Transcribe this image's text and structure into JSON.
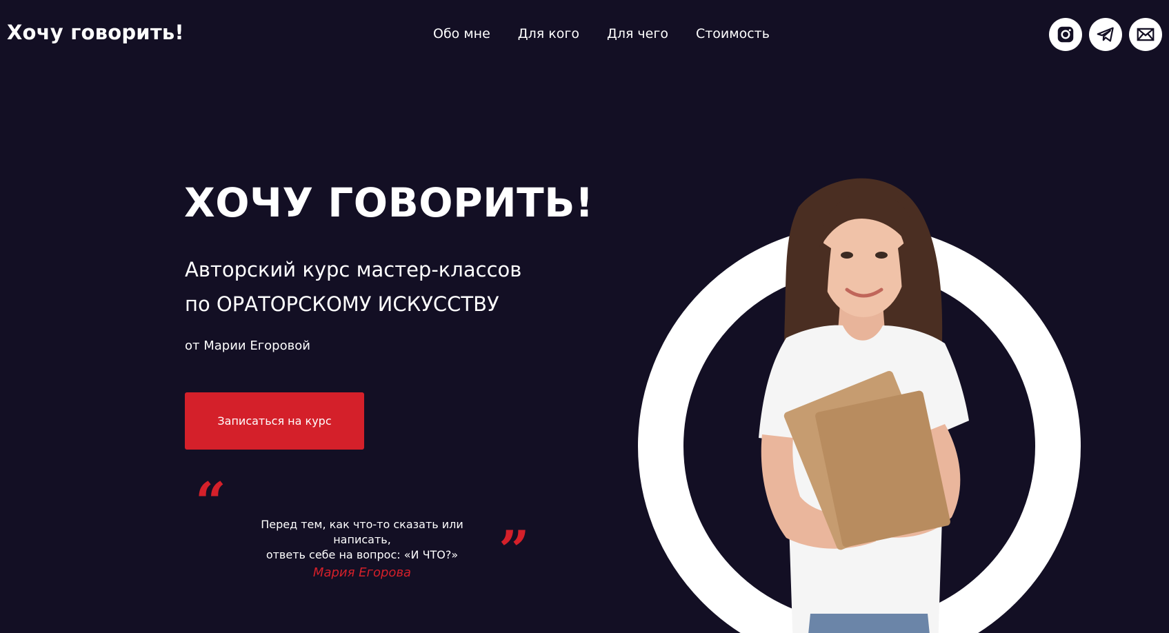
{
  "header": {
    "logo": "Хочу говорить!",
    "nav": [
      {
        "label": "Обо мне"
      },
      {
        "label": "Для кого"
      },
      {
        "label": "Для чего"
      },
      {
        "label": "Стоимость"
      }
    ],
    "socials": [
      {
        "icon": "instagram-icon"
      },
      {
        "icon": "telegram-icon"
      },
      {
        "icon": "mail-icon"
      }
    ]
  },
  "hero": {
    "title": "ХОЧУ ГОВОРИТЬ!",
    "subtitle_line1": "Авторский курс мастер-классов",
    "subtitle_line2": "по ОРАТОРСКОМУ ИСКУССТВУ",
    "author": "от Марии Егоровой",
    "cta_label": "Записаться на курс"
  },
  "quote": {
    "open_mark": "“",
    "close_mark": "”",
    "line1": "Перед тем, как что-то сказать или написать,",
    "line2": "ответь себе на вопрос: «И ЧТО?»",
    "author": "Мария Егорова"
  },
  "colors": {
    "background": "#130f24",
    "accent": "#d4202a",
    "text": "#ffffff"
  }
}
